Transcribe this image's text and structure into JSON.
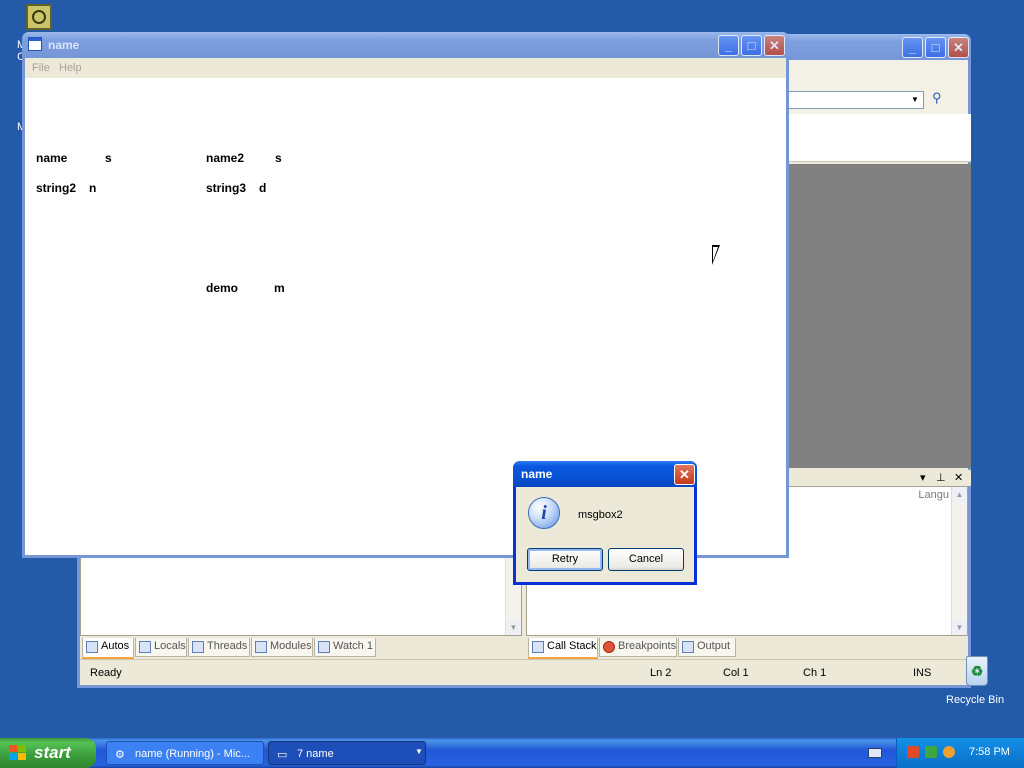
{
  "ide_window": {
    "pane_left_tabs": [
      "Autos",
      "Locals",
      "Threads",
      "Modules",
      "Watch 1"
    ],
    "pane_right_tabs": [
      "Call Stack",
      "Breakpoints",
      "Output"
    ],
    "pane_right_column": "Langu",
    "status": {
      "text": "Ready",
      "ln": "Ln 2",
      "col": "Col 1",
      "ch": "Ch 1",
      "ins": "INS"
    }
  },
  "app_window": {
    "title": "name",
    "menu": [
      "File",
      "Help"
    ],
    "labels": {
      "r1c1": "name",
      "r1c2": "s",
      "r1c3": "name2",
      "r1c4": "s",
      "r2c1": "string2",
      "r2c2": "n",
      "r2c3": "string3",
      "r2c4": "d",
      "r3c3": "demo",
      "r3c4": "m"
    }
  },
  "message_box": {
    "title": "name",
    "text": "msgbox2",
    "icon": "information-icon",
    "buttons": {
      "retry": "Retry",
      "cancel": "Cancel"
    }
  },
  "desktop": {
    "recycle_bin_label": "Recycle Bin",
    "fragments": [
      "M",
      "C",
      "M"
    ]
  },
  "taskbar": {
    "start_label": "start",
    "tasks": [
      "name (Running) - Mic...",
      "7 name"
    ],
    "clock": "7:58 PM"
  },
  "colors": {
    "desktop": "#235ba8",
    "titlebar_active": "#0653d6",
    "taskbar": "#2157d7",
    "start_button": "#3a9b3a",
    "tab_accent": "#f7a53a"
  }
}
